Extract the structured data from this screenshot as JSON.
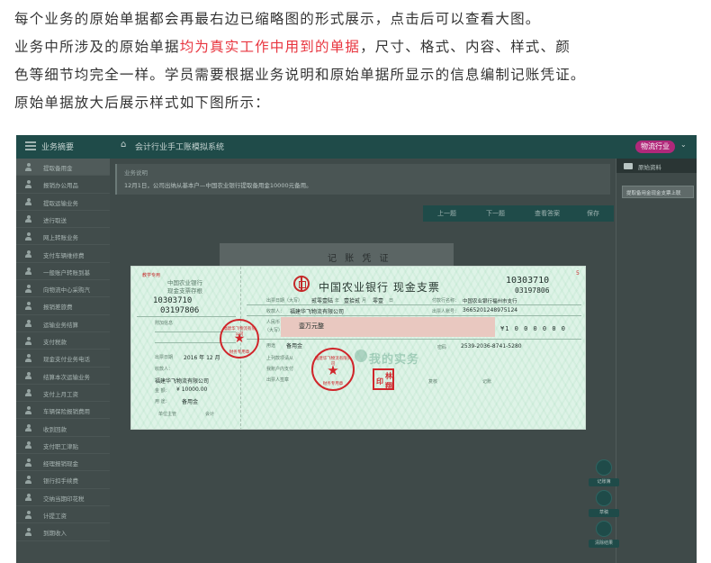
{
  "intro": {
    "line1": "每个业务的原始单据都会再最右边已缩略图的形式展示，点击后可以查看大图。",
    "line2_prefix": "业务中所涉及的原始单据",
    "line2_highlight": "均为真实工作中用到的单据",
    "line2_suffix": "，尺寸、格式、内容、样式、颜",
    "line3": "色等细节均完全一样。学员需要根据业务说明和原始单据所显示的信息编制记账凭证。",
    "line4": "原始单据放大后展示样式如下图所示："
  },
  "app": {
    "sidebar_title": "业务摘要",
    "breadcrumb": "会计行业手工账模拟系统",
    "user_label": "物流行业",
    "sidebar_items": [
      "提取备用金",
      "报销办公用品",
      "提取运输业务",
      "进行取送",
      "网上转账业务",
      "支付车辆维修费",
      "一般账户转账到基",
      "向物流中心采购汽",
      "报销差旅费",
      "运输业务结算",
      "支付税款",
      "现金支付业务电话",
      "结算本次运输业务",
      "支付上月工资",
      "车辆保险报销费用",
      "收到回款",
      "支付职工津贴",
      "经理报销现金",
      "银行扣手续费",
      "交纳当期印花税",
      "计提工资",
      "到期收入"
    ],
    "biz_header": "业务说明",
    "biz_desc": "12月1日，公司出纳从基本户—中国农业银行提取备用金10000元备用。",
    "buttons": [
      "上一题",
      "下一题",
      "查看答案",
      "保存"
    ],
    "voucher_title": "记 账 凭 证",
    "right_header": "原始资料",
    "thumb_label": "提取备用金现金支票上联",
    "fab_labels": [
      "记账簿",
      "草稿",
      "清除结果"
    ]
  },
  "check": {
    "corner_tag": "教学专用",
    "corner_num": "5",
    "stub_bank": "中国农业银行",
    "stub_title": "现金支票存根",
    "stub_serial1": "10303710",
    "stub_serial2": "03197806",
    "stub_extra": "附加信息",
    "stub_date_label": "出票日期",
    "stub_date": "2016 年 12 月",
    "stub_payee_label": "收款人：",
    "stub_payee": "福建华飞物流有限公司",
    "stub_amount_label": "金  额：",
    "stub_amount": "¥ 10000.00",
    "stub_use_label": "用  途：",
    "stub_use": "备用金",
    "stub_mgr": "单位主管",
    "stub_acct": "会计",
    "bank_title": "中国农业银行  现金支票",
    "serial1": "10303710",
    "serial2": "03197806",
    "date_label": "出票日期（大写）",
    "date_year": "贰零壹陆",
    "date_year_unit": "年",
    "date_month": "壹拾贰",
    "date_month_unit": "月",
    "date_day": "零壹",
    "date_day_unit": "日",
    "payer_bank_label": "付款行名称：",
    "payer_bank": "中国农业银行福州市支行",
    "payee_label": "收款人：",
    "payee": "福建华飞物流有限公司",
    "account_label": "出票人账号：",
    "account": "3665201248975124",
    "rmb_label": "人民币",
    "rmb_sub": "（大写）",
    "rmb_amount": "壹万元整",
    "figure_amount": "¥1 0 0 0 0 0 0",
    "use_label": "用途",
    "use": "备用金",
    "password_label": "密码",
    "password": "2539-2036-8741-5280",
    "above_label": "上列款项请从",
    "my_account": "我账户内支付",
    "drawer_sign": "出票人签章",
    "review": "复核",
    "bookkeep": "记账",
    "seal_text": "福建华飞物流有限公司",
    "seal_sub": "财务专用章",
    "seal_star": "★",
    "sq_seal_1": "林",
    "sq_seal_2": "翔",
    "sq_seal_3": "印",
    "watermark": "我的实务"
  }
}
